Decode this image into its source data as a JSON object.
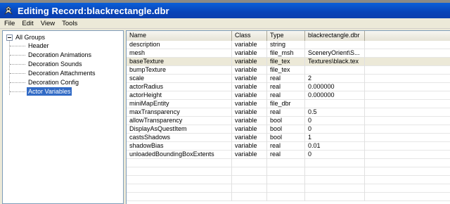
{
  "window": {
    "title": "Editing Record:blackrectangle.dbr"
  },
  "menu": [
    "File",
    "Edit",
    "View",
    "Tools"
  ],
  "tree": {
    "root": "All Groups",
    "children": [
      "Header",
      "Decoration Animations",
      "Decoration Sounds",
      "Decoration Attachments",
      "Decoration Config",
      "Actor Variables"
    ],
    "selected": "Actor Variables"
  },
  "grid": {
    "columns": [
      "Name",
      "Class",
      "Type",
      "blackrectangle.dbr"
    ],
    "rows": [
      [
        "description",
        "variable",
        "string",
        ""
      ],
      [
        "mesh",
        "variable",
        "file_msh",
        "SceneryOrient\\S..."
      ],
      [
        "baseTexture",
        "variable",
        "file_tex",
        "Textures\\black.tex"
      ],
      [
        "bumpTexture",
        "variable",
        "file_tex",
        ""
      ],
      [
        "scale",
        "variable",
        "real",
        "2"
      ],
      [
        "actorRadius",
        "variable",
        "real",
        "0.000000"
      ],
      [
        "actorHeight",
        "variable",
        "real",
        "0.000000"
      ],
      [
        "miniMapEntity",
        "variable",
        "file_dbr",
        ""
      ],
      [
        "maxTransparency",
        "variable",
        "real",
        "0.5"
      ],
      [
        "allowTransparency",
        "variable",
        "bool",
        "0"
      ],
      [
        "DisplayAsQuestItem",
        "variable",
        "bool",
        "0"
      ],
      [
        "castsShadows",
        "variable",
        "bool",
        "1"
      ],
      [
        "shadowBias",
        "variable",
        "real",
        "0.01"
      ],
      [
        "unloadedBoundingBoxExtents",
        "variable",
        "real",
        "0"
      ]
    ],
    "highlighted_row": 2
  },
  "colors": {
    "titlebar": "#0843b8",
    "selection": "#316ac5",
    "highlight_row": "#ece9d8"
  }
}
